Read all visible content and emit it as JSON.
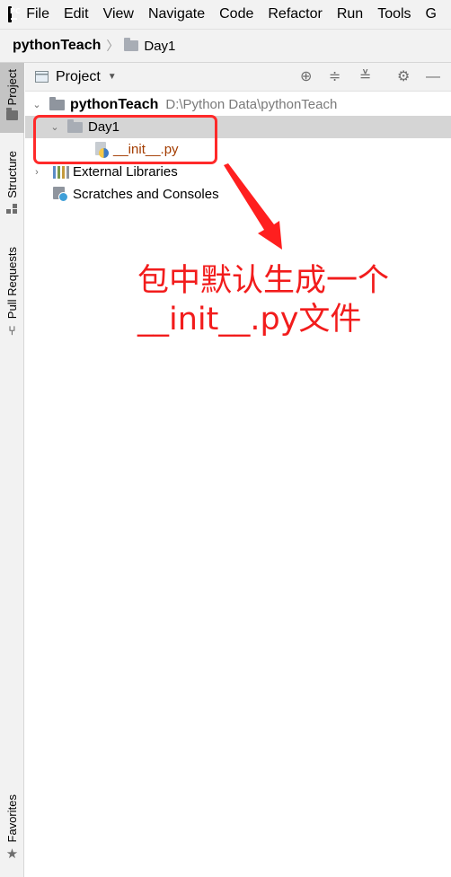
{
  "app": {
    "logo_text": "PC"
  },
  "menu": {
    "items": [
      "File",
      "Edit",
      "View",
      "Navigate",
      "Code",
      "Refactor",
      "Run",
      "Tools",
      "G"
    ]
  },
  "breadcrumb": {
    "root": "pythonTeach",
    "separator": "〉",
    "leaf": "Day1"
  },
  "left_strip": {
    "tabs": [
      {
        "label": "Project",
        "active": true
      },
      {
        "label": "Structure",
        "active": false
      },
      {
        "label": "Pull Requests",
        "active": false
      },
      {
        "label": "Favorites",
        "active": false
      }
    ]
  },
  "panel": {
    "title": "Project",
    "toolbar_icons": [
      "locate-icon",
      "expand-all-icon",
      "collapse-all-icon",
      "gear-icon",
      "minimize-icon"
    ]
  },
  "tree": {
    "root": {
      "name": "pythonTeach",
      "path": "D:\\Python Data\\pythonTeach"
    },
    "package": {
      "name": "Day1"
    },
    "file": {
      "name": "__init__.py"
    },
    "external": {
      "name": "External Libraries"
    },
    "scratches": {
      "name": "Scratches and Consoles"
    }
  },
  "annotation": {
    "line1": "包中默认生成一个",
    "line2": "__init__.py文件",
    "color": "#f21c1c"
  }
}
